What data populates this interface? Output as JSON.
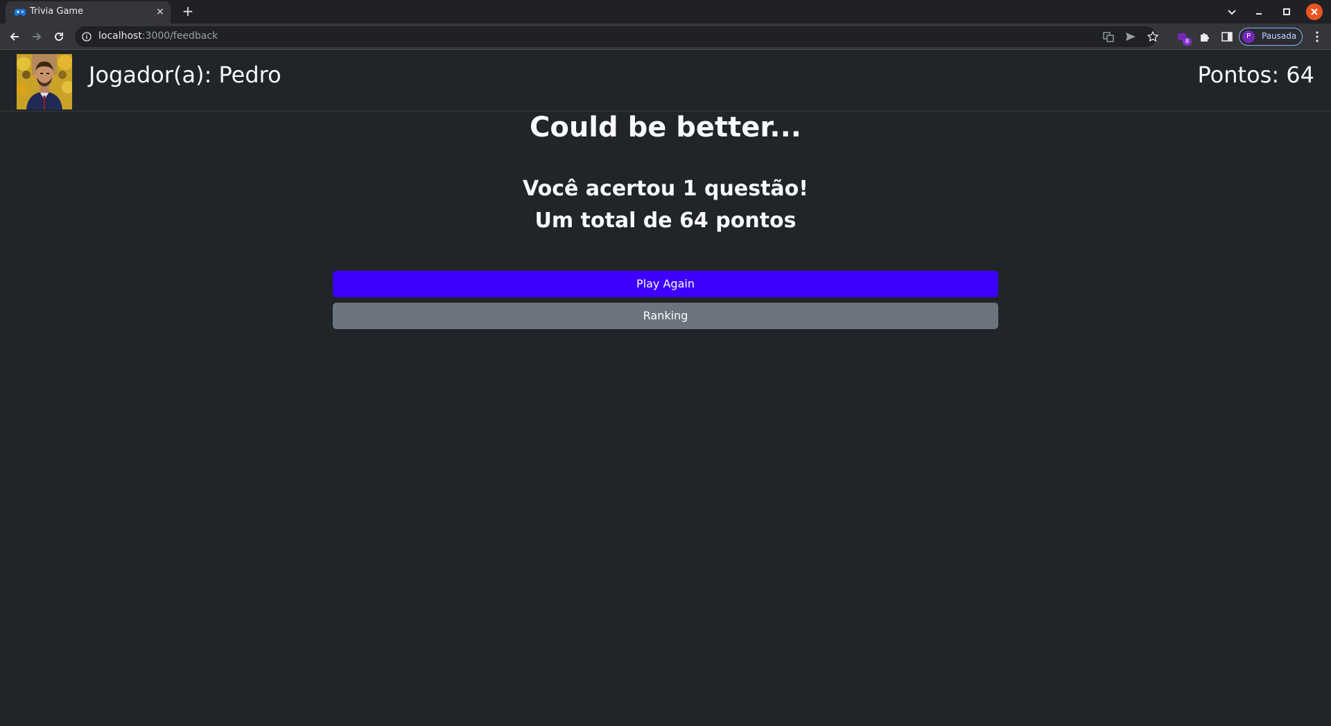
{
  "browser": {
    "tab_title": "Trivia Game",
    "tab_close": "×",
    "new_tab": "+",
    "url_host": "localhost",
    "url_path": ":3000/feedback",
    "extension_badge": "8",
    "profile_initial": "P",
    "profile_label": "Pausada"
  },
  "header": {
    "player_label": "Jogador(a): Pedro",
    "score_label": "Pontos: 64"
  },
  "feedback": {
    "message": "Could be better...",
    "assertions": "Você acertou 1 questão!",
    "total": "Um total de 64 pontos"
  },
  "buttons": {
    "play_again": "Play Again",
    "ranking": "Ranking"
  },
  "colors": {
    "page_bg": "#212529",
    "play_again_bg": "#3d00ff",
    "ranking_bg": "#6c757d",
    "close_window": "#e95420"
  }
}
